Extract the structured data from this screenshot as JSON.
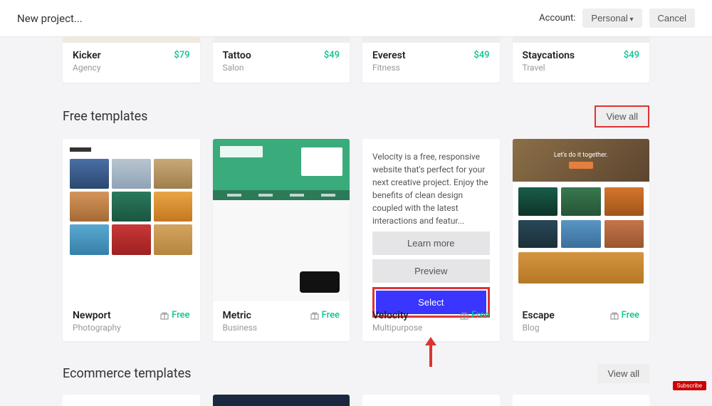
{
  "header": {
    "title": "New project...",
    "account_label": "Account:",
    "account_value": "Personal",
    "cancel": "Cancel"
  },
  "top_row": [
    {
      "name": "Kicker",
      "category": "Agency",
      "price": "$79"
    },
    {
      "name": "Tattoo",
      "category": "Salon",
      "price": "$49"
    },
    {
      "name": "Everest",
      "category": "Fitness",
      "price": "$49"
    },
    {
      "name": "Staycations",
      "category": "Travel",
      "price": "$49"
    }
  ],
  "sections": {
    "free": {
      "title": "Free templates",
      "view_all": "View all"
    },
    "ecom": {
      "title": "Ecommerce templates",
      "view_all": "View all"
    }
  },
  "free_templates": [
    {
      "name": "Newport",
      "category": "Photography",
      "price": "Free"
    },
    {
      "name": "Metric",
      "category": "Business",
      "price": "Free"
    },
    {
      "name": "Velocity",
      "category": "Multipurpose",
      "price": "Free"
    },
    {
      "name": "Escape",
      "category": "Blog",
      "price": "Free"
    }
  ],
  "velocity_hover": {
    "description": "Velocity is a free, responsive website that's perfect for your next creative project. Enjoy the benefits of clean design coupled with the latest interactions and featur...",
    "learn_more": "Learn more",
    "preview": "Preview",
    "select": "Select"
  },
  "escape_hero": "Let's do it together.",
  "subscribe": "Subscribe"
}
